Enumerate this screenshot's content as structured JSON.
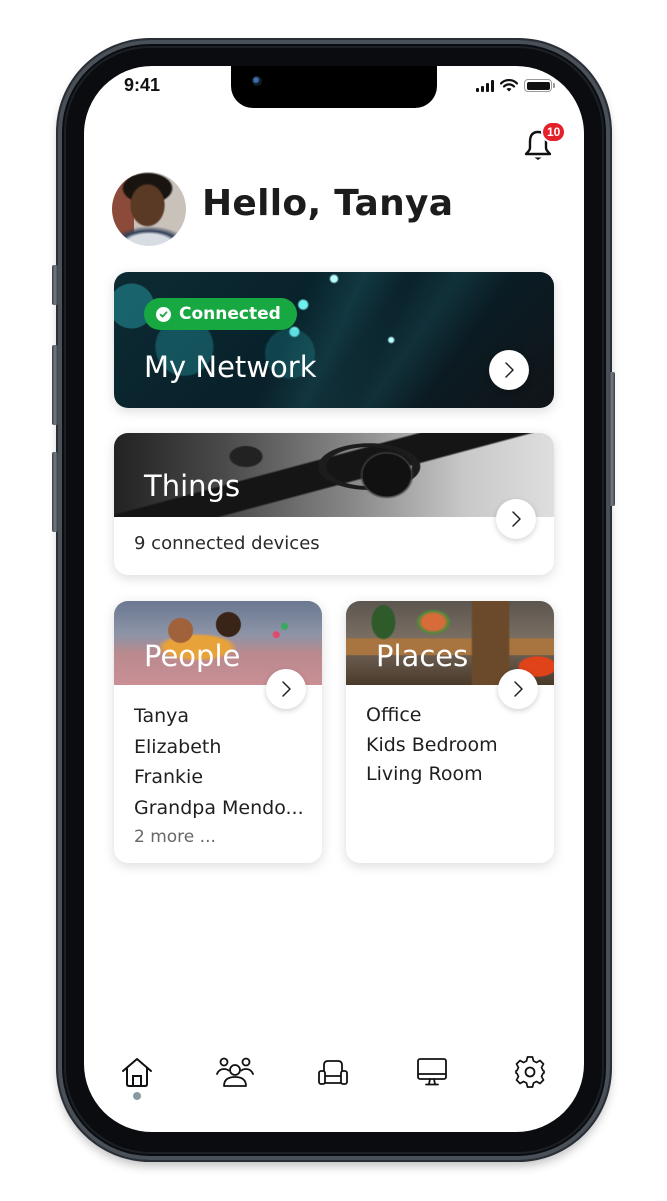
{
  "status_bar": {
    "time": "9:41",
    "signal_icon": "cellular-signal-icon",
    "wifi_icon": "wifi-icon",
    "battery_icon": "battery-icon"
  },
  "header": {
    "notification_icon": "bell-icon",
    "notification_count": "10",
    "greeting": "Hello, Tanya",
    "avatar_alt": "Tanya profile photo"
  },
  "network_card": {
    "status_label": "Connected",
    "status_color": "#17a842",
    "title": "My Network",
    "action_icon": "chevron-right-icon"
  },
  "things_card": {
    "title": "Things",
    "subtitle": "9 connected devices",
    "action_icon": "chevron-right-icon"
  },
  "people_card": {
    "title": "People",
    "items": [
      "Tanya",
      "Elizabeth",
      "Frankie",
      "Grandpa Mendo..."
    ],
    "more_label": "2 more ...",
    "action_icon": "chevron-right-icon"
  },
  "places_card": {
    "title": "Places",
    "items": [
      "Office",
      "Kids Bedroom",
      "Living Room"
    ],
    "action_icon": "chevron-right-icon"
  },
  "tab_bar": {
    "active": "home",
    "tabs": [
      {
        "id": "home",
        "icon": "home-icon"
      },
      {
        "id": "people",
        "icon": "people-group-icon"
      },
      {
        "id": "places",
        "icon": "armchair-icon"
      },
      {
        "id": "things",
        "icon": "monitor-icon"
      },
      {
        "id": "settings",
        "icon": "gear-icon"
      }
    ]
  },
  "colors": {
    "badge": "#e4202a",
    "connected": "#17a842",
    "active_indicator": "#8a9aa3"
  }
}
